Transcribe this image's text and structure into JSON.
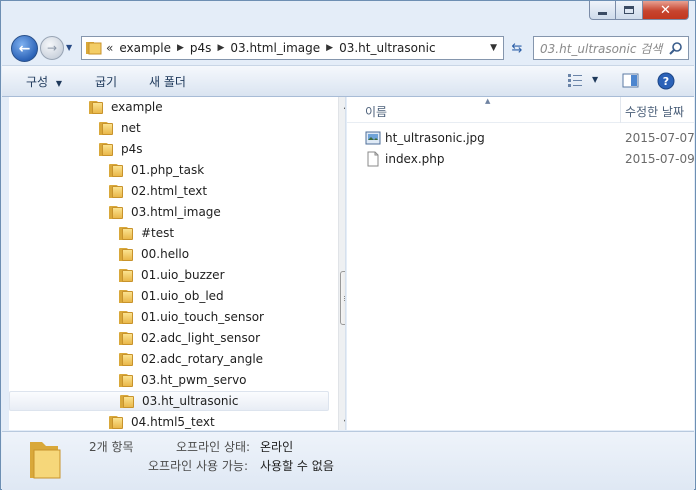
{
  "window": {
    "minimize_label": "minimize",
    "maximize_label": "maximize",
    "close_label": "close"
  },
  "address": {
    "crumbs": [
      "example",
      "p4s",
      "03.html_image",
      "03.ht_ultrasonic"
    ],
    "overflow": "«"
  },
  "search": {
    "placeholder": "03.ht_ultrasonic 검색"
  },
  "toolbar": {
    "organize": "구성",
    "burn": "굽기",
    "new_folder": "새 폴더"
  },
  "tree": [
    {
      "label": "example",
      "level": 0
    },
    {
      "label": "net",
      "level": 1
    },
    {
      "label": "p4s",
      "level": 1
    },
    {
      "label": "01.php_task",
      "level": 2
    },
    {
      "label": "02.html_text",
      "level": 2
    },
    {
      "label": "03.html_image",
      "level": 2
    },
    {
      "label": "#test",
      "level": 3
    },
    {
      "label": "00.hello",
      "level": 3
    },
    {
      "label": "01.uio_buzzer",
      "level": 3
    },
    {
      "label": "01.uio_ob_led",
      "level": 3
    },
    {
      "label": "01.uio_touch_sensor",
      "level": 3
    },
    {
      "label": "02.adc_light_sensor",
      "level": 3
    },
    {
      "label": "02.adc_rotary_angle",
      "level": 3
    },
    {
      "label": "03.ht_pwm_servo",
      "level": 3
    },
    {
      "label": "03.ht_ultrasonic",
      "level": 3,
      "selected": true
    },
    {
      "label": "04.html5_text",
      "level": 2
    }
  ],
  "columns": {
    "name": "이름",
    "modified": "수정한 날짜"
  },
  "files": [
    {
      "name": "ht_ultrasonic.jpg",
      "icon": "image-file-icon",
      "date": "2015-07-07"
    },
    {
      "name": "index.php",
      "icon": "document-file-icon",
      "date": "2015-07-09"
    }
  ],
  "details": {
    "count": "2개 항목",
    "offline_status_label": "오프라인 상태:",
    "offline_status_value": "온라인",
    "offline_avail_label": "오프라인 사용 가능:",
    "offline_avail_value": "사용할 수 없음"
  }
}
